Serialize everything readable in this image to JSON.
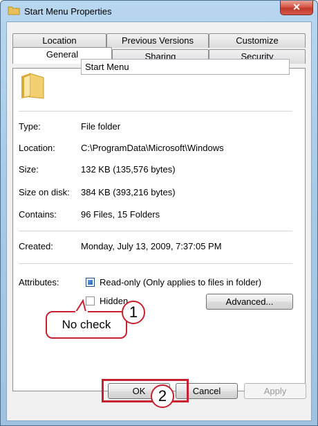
{
  "window": {
    "title": "Start Menu Properties",
    "close_label": "✕"
  },
  "tabs_row1": [
    "Location",
    "Previous Versions",
    "Customize"
  ],
  "tabs_row2": [
    "General",
    "Sharing",
    "Security"
  ],
  "active_tab": "General",
  "general": {
    "name_value": "Start Menu",
    "fields": {
      "type": {
        "label": "Type:",
        "value": "File folder"
      },
      "location": {
        "label": "Location:",
        "value": "C:\\ProgramData\\Microsoft\\Windows"
      },
      "size": {
        "label": "Size:",
        "value": "132 KB (135,576 bytes)"
      },
      "size_on_disk": {
        "label": "Size on disk:",
        "value": "384 KB (393,216 bytes)"
      },
      "contains": {
        "label": "Contains:",
        "value": "96 Files, 15 Folders"
      },
      "created": {
        "label": "Created:",
        "value": "Monday, July 13, 2009, 7:37:05 PM"
      }
    },
    "attributes_label": "Attributes:",
    "readonly_label": "Read-only (Only applies to files in folder)",
    "readonly_checked": true,
    "hidden_label": "Hidden",
    "hidden_checked": false,
    "advanced_label": "Advanced..."
  },
  "buttons": {
    "ok": "OK",
    "cancel": "Cancel",
    "apply": "Apply"
  },
  "annotations": {
    "callout_text": "No check",
    "step1": "1",
    "step2": "2"
  },
  "colors": {
    "annotation_red": "#c8202f",
    "titlebar_blue": "#b8d6ef"
  }
}
